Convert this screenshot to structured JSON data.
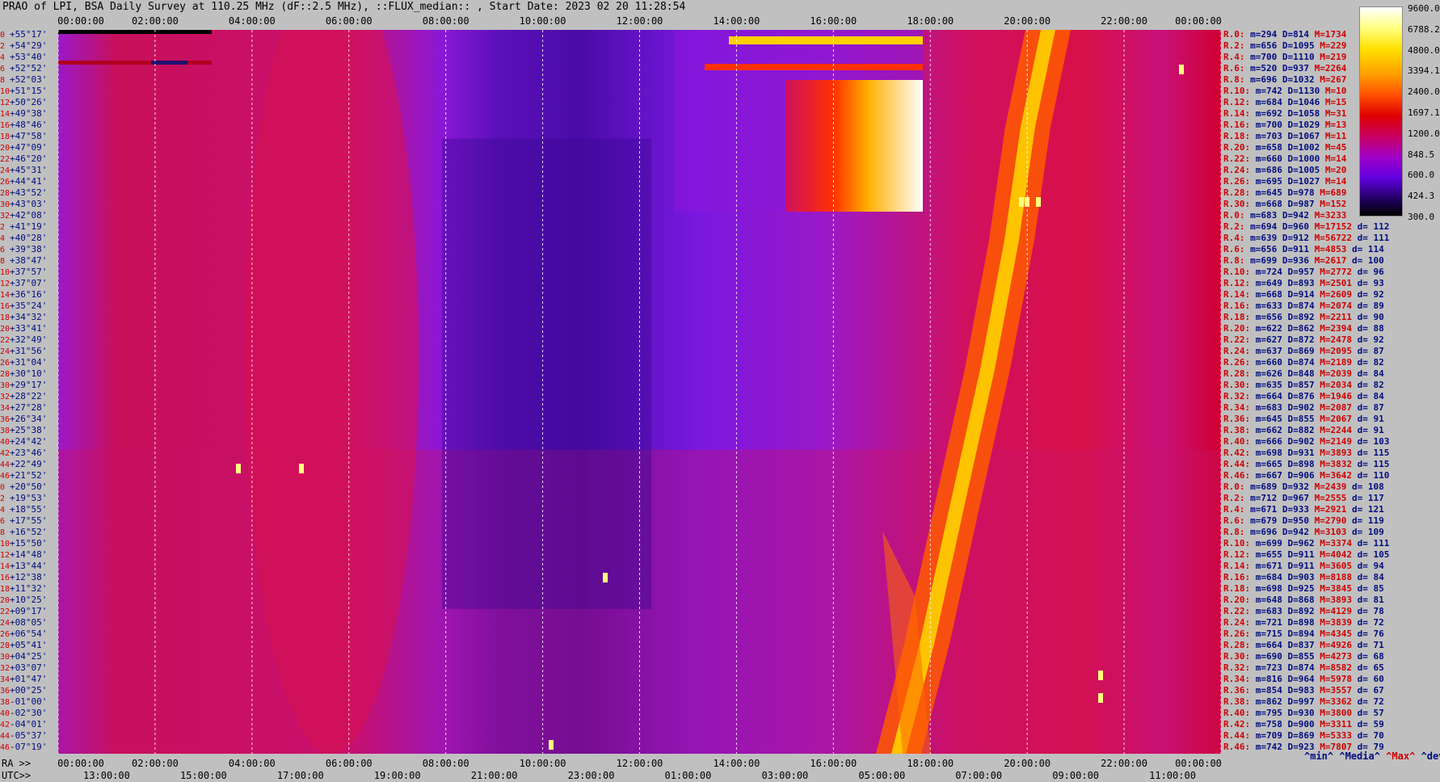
{
  "title": "PRAO of LPI, BSA Daily Survey at 110.25 MHz (dF::2.5 MHz), ::FLUX_median:: , Start Date: 2023 02 20 11:28:54",
  "axis": {
    "top_ticks": [
      "00:00:00",
      "02:00:00",
      "04:00:00",
      "06:00:00",
      "08:00:00",
      "10:00:00",
      "12:00:00",
      "14:00:00",
      "16:00:00",
      "18:00:00",
      "20:00:00",
      "22:00:00",
      "00:00:00"
    ],
    "ra_prefix": "RA >>",
    "bottom_ticks": [
      "00:00:00",
      "02:00:00",
      "04:00:00",
      "06:00:00",
      "08:00:00",
      "10:00:00",
      "12:00:00",
      "14:00:00",
      "16:00:00",
      "18:00:00",
      "20:00:00",
      "22:00:00",
      "00:00:00"
    ],
    "utc_prefix": "UTC>>",
    "utc_ticks": [
      "13:00:00",
      "15:00:00",
      "17:00:00",
      "19:00:00",
      "21:00:00",
      "23:00:00",
      "01:00:00",
      "03:00:00",
      "05:00:00",
      "07:00:00",
      "09:00:00",
      "11:00:00"
    ]
  },
  "rows": [
    {
      "i": "0",
      "dec": "+55°17'"
    },
    {
      "i": "2",
      "dec": "+54°29'"
    },
    {
      "i": "4",
      "dec": "+53°40'"
    },
    {
      "i": "6",
      "dec": "+52°52'"
    },
    {
      "i": "8",
      "dec": "+52°03'"
    },
    {
      "i": "10",
      "dec": "+51°15'"
    },
    {
      "i": "12",
      "dec": "+50°26'"
    },
    {
      "i": "14",
      "dec": "+49°38'"
    },
    {
      "i": "16",
      "dec": "+48°46'"
    },
    {
      "i": "18",
      "dec": "+47°58'"
    },
    {
      "i": "20",
      "dec": "+47°09'"
    },
    {
      "i": "22",
      "dec": "+46°20'"
    },
    {
      "i": "24",
      "dec": "+45°31'"
    },
    {
      "i": "26",
      "dec": "+44°41'"
    },
    {
      "i": "28",
      "dec": "+43°52'"
    },
    {
      "i": "30",
      "dec": "+43°03'"
    },
    {
      "i": "32",
      "dec": "+42°08'"
    },
    {
      "i": "2",
      "dec": "+41°19'"
    },
    {
      "i": "4",
      "dec": "+40°28'"
    },
    {
      "i": "6",
      "dec": "+39°38'"
    },
    {
      "i": "8",
      "dec": "+38°47'"
    },
    {
      "i": "10",
      "dec": "+37°57'"
    },
    {
      "i": "12",
      "dec": "+37°07'"
    },
    {
      "i": "14",
      "dec": "+36°16'"
    },
    {
      "i": "16",
      "dec": "+35°24'"
    },
    {
      "i": "18",
      "dec": "+34°32'"
    },
    {
      "i": "20",
      "dec": "+33°41'"
    },
    {
      "i": "22",
      "dec": "+32°49'"
    },
    {
      "i": "24",
      "dec": "+31°56'"
    },
    {
      "i": "26",
      "dec": "+31°04'"
    },
    {
      "i": "28",
      "dec": "+30°10'"
    },
    {
      "i": "30",
      "dec": "+29°17'"
    },
    {
      "i": "32",
      "dec": "+28°22'"
    },
    {
      "i": "34",
      "dec": "+27°28'"
    },
    {
      "i": "36",
      "dec": "+26°34'"
    },
    {
      "i": "38",
      "dec": "+25°38'"
    },
    {
      "i": "40",
      "dec": "+24°42'"
    },
    {
      "i": "42",
      "dec": "+23°46'"
    },
    {
      "i": "44",
      "dec": "+22°49'"
    },
    {
      "i": "46",
      "dec": "+21°52'"
    },
    {
      "i": "0",
      "dec": "+20°50'"
    },
    {
      "i": "2",
      "dec": "+19°53'"
    },
    {
      "i": "4",
      "dec": "+18°55'"
    },
    {
      "i": "6",
      "dec": "+17°55'"
    },
    {
      "i": "8",
      "dec": "+16°52'"
    },
    {
      "i": "10",
      "dec": "+15°50'"
    },
    {
      "i": "12",
      "dec": "+14°48'"
    },
    {
      "i": "14",
      "dec": "+13°44'"
    },
    {
      "i": "16",
      "dec": "+12°38'"
    },
    {
      "i": "18",
      "dec": "+11°32'"
    },
    {
      "i": "20",
      "dec": "+10°25'"
    },
    {
      "i": "22",
      "dec": "+09°17'"
    },
    {
      "i": "24",
      "dec": "+08°05'"
    },
    {
      "i": "26",
      "dec": "+06°54'"
    },
    {
      "i": "28",
      "dec": "+05°41'"
    },
    {
      "i": "30",
      "dec": "+04°25'"
    },
    {
      "i": "32",
      "dec": "+03°07'"
    },
    {
      "i": "34",
      "dec": "+01°47'"
    },
    {
      "i": "36",
      "dec": "+00°25'"
    },
    {
      "i": "38",
      "dec": "-01°00'"
    },
    {
      "i": "40",
      "dec": "-02°30'"
    },
    {
      "i": "42",
      "dec": "-04°01'"
    },
    {
      "i": "44",
      "dec": "-05°37'"
    },
    {
      "i": "46",
      "dec": "-07°19'"
    }
  ],
  "stats": [
    {
      "r": "R.0:",
      "m": "m=294",
      "d": "D=814",
      "h": "M=1734",
      "dd": ""
    },
    {
      "r": "R.2:",
      "m": "m=656",
      "d": "D=1095",
      "h": "M=229",
      "dd": ""
    },
    {
      "r": "R.4:",
      "m": "m=700",
      "d": "D=1110",
      "h": "M=219",
      "dd": ""
    },
    {
      "r": "R.6:",
      "m": "m=520",
      "d": "D=937",
      "h": "M=2264",
      "dd": ""
    },
    {
      "r": "R.8:",
      "m": "m=696",
      "d": "D=1032",
      "h": "M=267",
      "dd": ""
    },
    {
      "r": "R.10:",
      "m": "m=742",
      "d": "D=1130",
      "h": "M=10",
      "dd": ""
    },
    {
      "r": "R.12:",
      "m": "m=684",
      "d": "D=1046",
      "h": "M=15",
      "dd": ""
    },
    {
      "r": "R.14:",
      "m": "m=692",
      "d": "D=1058",
      "h": "M=31",
      "dd": ""
    },
    {
      "r": "R.16:",
      "m": "m=700",
      "d": "D=1029",
      "h": "M=13",
      "dd": ""
    },
    {
      "r": "R.18:",
      "m": "m=703",
      "d": "D=1067",
      "h": "M=11",
      "dd": ""
    },
    {
      "r": "R.20:",
      "m": "m=658",
      "d": "D=1002",
      "h": "M=45",
      "dd": ""
    },
    {
      "r": "R.22:",
      "m": "m=660",
      "d": "D=1000",
      "h": "M=14",
      "dd": ""
    },
    {
      "r": "R.24:",
      "m": "m=686",
      "d": "D=1005",
      "h": "M=20",
      "dd": ""
    },
    {
      "r": "R.26:",
      "m": "m=695",
      "d": "D=1027",
      "h": "M=14",
      "dd": ""
    },
    {
      "r": "R.28:",
      "m": "m=645",
      "d": "D=978",
      "h": "M=689",
      "dd": ""
    },
    {
      "r": "R.30:",
      "m": "m=668",
      "d": "D=987",
      "h": "M=152",
      "dd": ""
    },
    {
      "r": "R.0:",
      "m": "m=683",
      "d": "D=942",
      "h": "M=3233",
      "dd": ""
    },
    {
      "r": "R.2:",
      "m": "m=694",
      "d": "D=960",
      "h": "M=17152",
      "dd": "d= 112"
    },
    {
      "r": "R.4:",
      "m": "m=639",
      "d": "D=912",
      "h": "M=56722",
      "dd": "d= 111"
    },
    {
      "r": "R.6:",
      "m": "m=656",
      "d": "D=911",
      "h": "M=4853",
      "dd": "d= 114"
    },
    {
      "r": "R.8:",
      "m": "m=699",
      "d": "D=936",
      "h": "M=2617",
      "dd": "d= 100"
    },
    {
      "r": "R.10:",
      "m": "m=724",
      "d": "D=957",
      "h": "M=2772",
      "dd": "d= 96"
    },
    {
      "r": "R.12:",
      "m": "m=649",
      "d": "D=893",
      "h": "M=2501",
      "dd": "d= 93"
    },
    {
      "r": "R.14:",
      "m": "m=668",
      "d": "D=914",
      "h": "M=2609",
      "dd": "d= 92"
    },
    {
      "r": "R.16:",
      "m": "m=633",
      "d": "D=874",
      "h": "M=2074",
      "dd": "d= 89"
    },
    {
      "r": "R.18:",
      "m": "m=656",
      "d": "D=892",
      "h": "M=2211",
      "dd": "d= 90"
    },
    {
      "r": "R.20:",
      "m": "m=622",
      "d": "D=862",
      "h": "M=2394",
      "dd": "d= 88"
    },
    {
      "r": "R.22:",
      "m": "m=627",
      "d": "D=872",
      "h": "M=2478",
      "dd": "d= 92"
    },
    {
      "r": "R.24:",
      "m": "m=637",
      "d": "D=869",
      "h": "M=2095",
      "dd": "d= 87"
    },
    {
      "r": "R.26:",
      "m": "m=660",
      "d": "D=874",
      "h": "M=2189",
      "dd": "d= 82"
    },
    {
      "r": "R.28:",
      "m": "m=626",
      "d": "D=848",
      "h": "M=2039",
      "dd": "d= 84"
    },
    {
      "r": "R.30:",
      "m": "m=635",
      "d": "D=857",
      "h": "M=2034",
      "dd": "d= 82"
    },
    {
      "r": "R.32:",
      "m": "m=664",
      "d": "D=876",
      "h": "M=1946",
      "dd": "d= 84"
    },
    {
      "r": "R.34:",
      "m": "m=683",
      "d": "D=902",
      "h": "M=2087",
      "dd": "d= 87"
    },
    {
      "r": "R.36:",
      "m": "m=645",
      "d": "D=855",
      "h": "M=2067",
      "dd": "d= 91"
    },
    {
      "r": "R.38:",
      "m": "m=662",
      "d": "D=882",
      "h": "M=2244",
      "dd": "d= 91"
    },
    {
      "r": "R.40:",
      "m": "m=666",
      "d": "D=902",
      "h": "M=2149",
      "dd": "d= 103"
    },
    {
      "r": "R.42:",
      "m": "m=698",
      "d": "D=931",
      "h": "M=3893",
      "dd": "d= 115"
    },
    {
      "r": "R.44:",
      "m": "m=665",
      "d": "D=898",
      "h": "M=3832",
      "dd": "d= 115"
    },
    {
      "r": "R.46:",
      "m": "m=667",
      "d": "D=906",
      "h": "M=3642",
      "dd": "d= 110"
    },
    {
      "r": "R.0:",
      "m": "m=689",
      "d": "D=932",
      "h": "M=2439",
      "dd": "d= 108"
    },
    {
      "r": "R.2:",
      "m": "m=712",
      "d": "D=967",
      "h": "M=2555",
      "dd": "d= 117"
    },
    {
      "r": "R.4:",
      "m": "m=671",
      "d": "D=933",
      "h": "M=2921",
      "dd": "d= 121"
    },
    {
      "r": "R.6:",
      "m": "m=679",
      "d": "D=950",
      "h": "M=2790",
      "dd": "d= 119"
    },
    {
      "r": "R.8:",
      "m": "m=696",
      "d": "D=942",
      "h": "M=3103",
      "dd": "d= 109"
    },
    {
      "r": "R.10:",
      "m": "m=699",
      "d": "D=962",
      "h": "M=3374",
      "dd": "d= 111"
    },
    {
      "r": "R.12:",
      "m": "m=655",
      "d": "D=911",
      "h": "M=4042",
      "dd": "d= 105"
    },
    {
      "r": "R.14:",
      "m": "m=671",
      "d": "D=911",
      "h": "M=3605",
      "dd": "d= 94"
    },
    {
      "r": "R.16:",
      "m": "m=684",
      "d": "D=903",
      "h": "M=8188",
      "dd": "d= 84"
    },
    {
      "r": "R.18:",
      "m": "m=698",
      "d": "D=925",
      "h": "M=3845",
      "dd": "d= 85"
    },
    {
      "r": "R.20:",
      "m": "m=648",
      "d": "D=868",
      "h": "M=3893",
      "dd": "d= 81"
    },
    {
      "r": "R.22:",
      "m": "m=683",
      "d": "D=892",
      "h": "M=4129",
      "dd": "d= 78"
    },
    {
      "r": "R.24:",
      "m": "m=721",
      "d": "D=898",
      "h": "M=3839",
      "dd": "d= 72"
    },
    {
      "r": "R.26:",
      "m": "m=715",
      "d": "D=894",
      "h": "M=4345",
      "dd": "d= 76"
    },
    {
      "r": "R.28:",
      "m": "m=664",
      "d": "D=837",
      "h": "M=4926",
      "dd": "d= 71"
    },
    {
      "r": "R.30:",
      "m": "m=690",
      "d": "D=855",
      "h": "M=4273",
      "dd": "d= 68"
    },
    {
      "r": "R.32:",
      "m": "m=723",
      "d": "D=874",
      "h": "M=8582",
      "dd": "d= 65"
    },
    {
      "r": "R.34:",
      "m": "m=816",
      "d": "D=964",
      "h": "M=5978",
      "dd": "d= 60"
    },
    {
      "r": "R.36:",
      "m": "m=854",
      "d": "D=983",
      "h": "M=3557",
      "dd": "d= 67"
    },
    {
      "r": "R.38:",
      "m": "m=862",
      "d": "D=997",
      "h": "M=3362",
      "dd": "d= 72"
    },
    {
      "r": "R.40:",
      "m": "m=795",
      "d": "D=930",
      "h": "M=3800",
      "dd": "d= 57"
    },
    {
      "r": "R.42:",
      "m": "m=758",
      "d": "D=900",
      "h": "M=3311",
      "dd": "d= 59"
    },
    {
      "r": "R.44:",
      "m": "m=709",
      "d": "D=869",
      "h": "M=5333",
      "dd": "d= 70"
    },
    {
      "r": "R.46:",
      "m": "m=742",
      "d": "D=923",
      "h": "M=7807",
      "dd": "d= 79"
    }
  ],
  "legend": {
    "min": "^min^",
    "median": "^Media^",
    "max": "^Max^",
    "devia": "^devia^"
  },
  "colorbar": {
    "ticks": [
      "9600.0",
      "6788.2",
      "4800.0",
      "3394.1",
      "2400.0",
      "1697.1",
      "1200.0",
      "848.5",
      "600.0",
      "424.3",
      "300.0"
    ]
  },
  "chart_data": {
    "type": "heatmap",
    "title": "PRAO of LPI, BSA Daily Survey at 110.25 MHz (dF::2.5 MHz), ::FLUX_median:: , Start Date: 2023 02 20 11:28:54",
    "xlabel": "RA",
    "x_ticks": [
      "00:00:00",
      "02:00:00",
      "04:00:00",
      "06:00:00",
      "08:00:00",
      "10:00:00",
      "12:00:00",
      "14:00:00",
      "16:00:00",
      "18:00:00",
      "20:00:00",
      "22:00:00",
      "00:00:00"
    ],
    "x2label": "UTC",
    "x2_ticks": [
      "13:00:00",
      "15:00:00",
      "17:00:00",
      "19:00:00",
      "21:00:00",
      "23:00:00",
      "01:00:00",
      "03:00:00",
      "05:00:00",
      "07:00:00",
      "09:00:00",
      "11:00:00"
    ],
    "colorbar_range": [
      300,
      9600
    ],
    "colorbar_scale": "log",
    "grid": true
  }
}
